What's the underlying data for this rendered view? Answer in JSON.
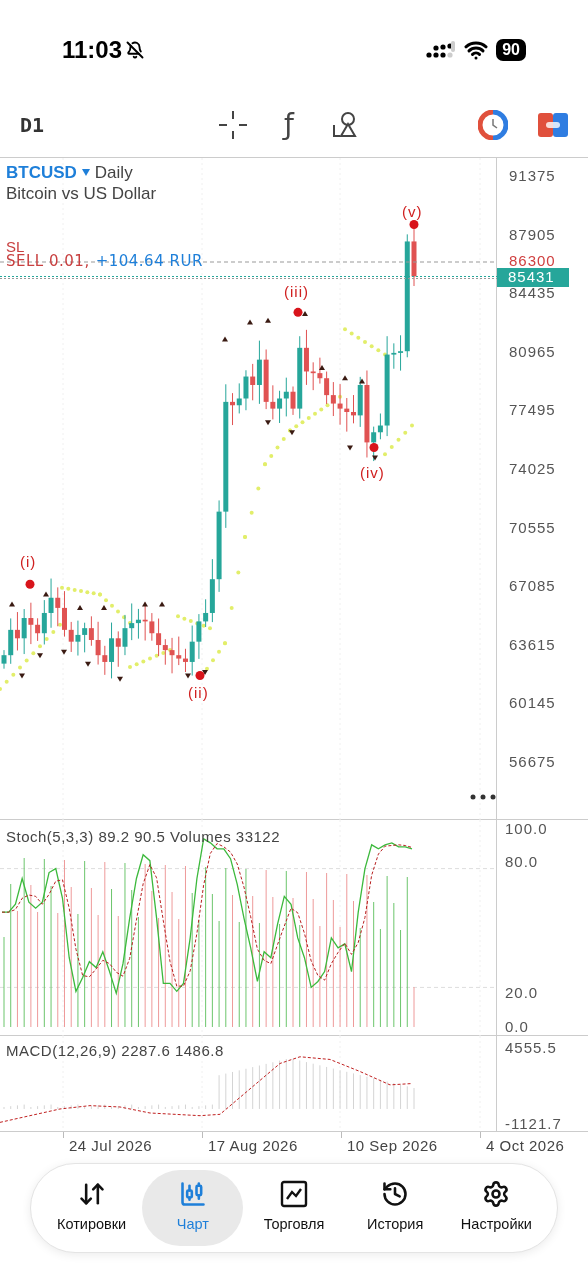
{
  "status_bar": {
    "time": "11:03",
    "battery": "90"
  },
  "toolbar": {
    "timeframe": "D1",
    "function_label": "ƒ"
  },
  "chart": {
    "symbol": "BTCUSD",
    "period": "Daily",
    "description": "Bitcoin vs US Dollar",
    "order_lines": [
      {
        "kind": "sl",
        "label": "SL"
      },
      {
        "kind": "position",
        "label": "SELL 0.01,",
        "profit": "+104.64 RUR"
      }
    ],
    "price_badges": [
      {
        "kind": "stop",
        "value": "86300"
      },
      {
        "kind": "last",
        "value": "85431"
      }
    ],
    "wave_labels": [
      "(i)",
      "(ii)",
      "(iii)",
      "(iv)",
      "(v)"
    ],
    "price_axis": [
      "91375",
      "87905",
      "84435",
      "80965",
      "77495",
      "74025",
      "70555",
      "67085",
      "63615",
      "60145",
      "56675"
    ]
  },
  "stoch": {
    "label": "Stoch(5,3,3) 89.2 90.5 Volumes 33122",
    "axis": [
      "100.0",
      "80.0",
      "20.0",
      "0.0"
    ]
  },
  "macd": {
    "label": "MACD(12,26,9) 2287.6 1486.8",
    "axis": [
      "4555.5",
      "-1121.7"
    ]
  },
  "date_axis": [
    "24 Jul 2026",
    "17 Aug 2026",
    "10 Sep 2026",
    "4 Oct 2026"
  ],
  "nav": [
    {
      "label": "Котировки",
      "selected": false
    },
    {
      "label": "Чарт",
      "selected": true
    },
    {
      "label": "Торговля",
      "selected": false
    },
    {
      "label": "История",
      "selected": false
    },
    {
      "label": "Настройки",
      "selected": false
    }
  ]
}
